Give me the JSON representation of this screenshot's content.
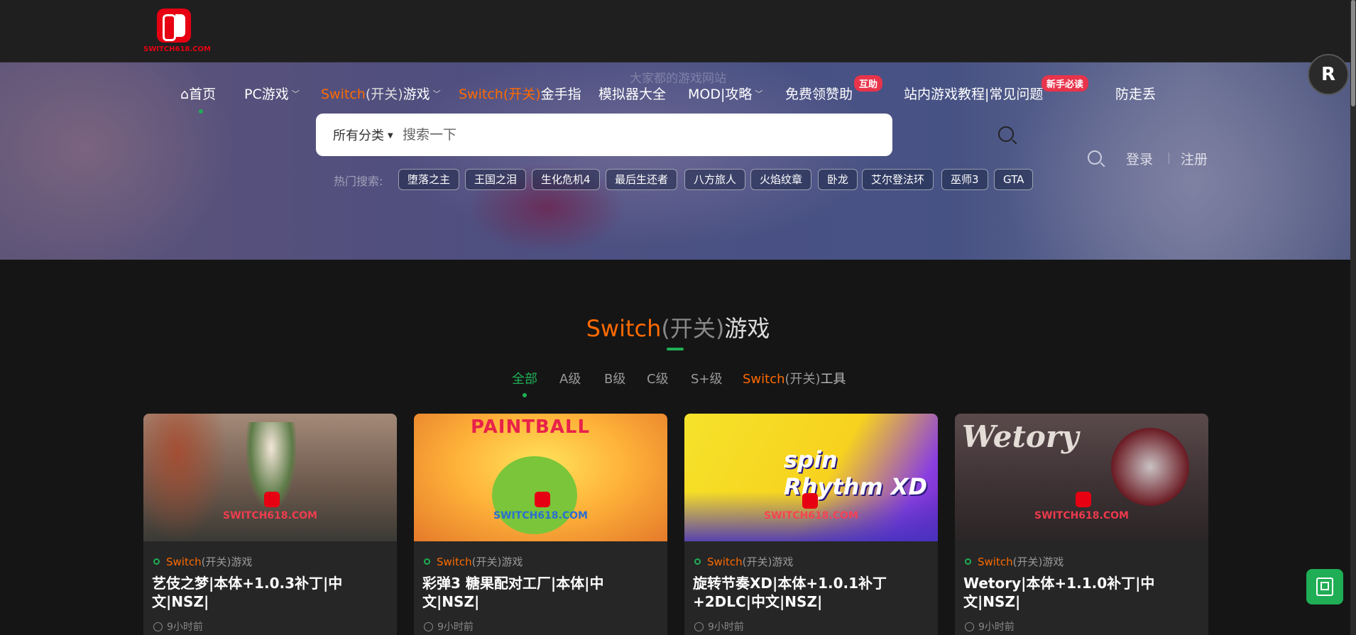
{
  "logo": {
    "text": "SWITCH618.COM"
  },
  "hero": {
    "tagline": "大家都的游戏网站"
  },
  "nav": {
    "items": [
      {
        "label": "首页",
        "icon": "home-icon"
      },
      {
        "label_orange": "",
        "label": "PC游戏",
        "has_dropdown": true
      },
      {
        "label_orange": "Switch",
        "label_gray": "(开关)",
        "label": "游戏",
        "has_dropdown": true
      },
      {
        "label_orange": "Switch",
        "label_gray": "(开关)",
        "label": "金手指"
      },
      {
        "label": "模拟器大全"
      },
      {
        "label": "MOD|攻略",
        "has_dropdown": true
      },
      {
        "label": "免费领赞助",
        "badge": "互助"
      },
      {
        "label": "站内游戏教程|常见问题",
        "badge": "新手必读"
      },
      {
        "label": "防走丢"
      }
    ]
  },
  "search": {
    "category": "所有分类",
    "placeholder": "搜索一下"
  },
  "hot_search": {
    "label": "热门搜索:",
    "tags": [
      "堕落之主",
      "王国之泪",
      "生化危机4",
      "最后生还者",
      "八方旅人",
      "火焰纹章",
      "卧龙",
      "艾尔登法环",
      "巫师3",
      "GTA"
    ]
  },
  "account": {
    "login": "登录",
    "register": "注册"
  },
  "float": {
    "avatar_letter": "R"
  },
  "section": {
    "title_orange": "Switch",
    "title_gray": "(开关)",
    "title_rest": "游戏",
    "filters": [
      {
        "label": "全部",
        "active": true
      },
      {
        "label": "A级"
      },
      {
        "label": "B级"
      },
      {
        "label": "C级"
      },
      {
        "label": "S+级"
      },
      {
        "label_orange": "Switch",
        "label_gray": "(开关)",
        "label": "工具"
      }
    ]
  },
  "cards": [
    {
      "art_text": "",
      "watermark": "SWITCH618.COM",
      "cat_orange": "Switch",
      "cat_gray": "(开关)",
      "cat_rest": "游戏",
      "title": "艺伎之梦|本体+1.0.3补丁|中文|NSZ|",
      "time": "9小时前"
    },
    {
      "art_text": "PAINTBALL",
      "watermark": "SWITCH618.COM",
      "cat_orange": "Switch",
      "cat_gray": "(开关)",
      "cat_rest": "游戏",
      "title": "彩弹3 糖果配对工厂|本体|中文|NSZ|",
      "time": "9小时前"
    },
    {
      "art_text": "spin Rhythm XD",
      "watermark": "SWITCH618.COM",
      "cat_orange": "Switch",
      "cat_gray": "(开关)",
      "cat_rest": "游戏",
      "title": "旋转节奏XD|本体+1.0.1补丁+2DLC|中文|NSZ|",
      "time": "9小时前"
    },
    {
      "art_text": "Wetory",
      "watermark": "SWITCH618.COM",
      "cat_orange": "Switch",
      "cat_gray": "(开关)",
      "cat_rest": "游戏",
      "title": "Wetory|本体+1.1.0补丁|中文|NSZ|",
      "time": "9小时前"
    }
  ],
  "colors": {
    "accent_green": "#1fae55",
    "accent_orange": "#ff6a00",
    "badge_red": "#e8344b",
    "nintendo_red": "#e60012"
  }
}
